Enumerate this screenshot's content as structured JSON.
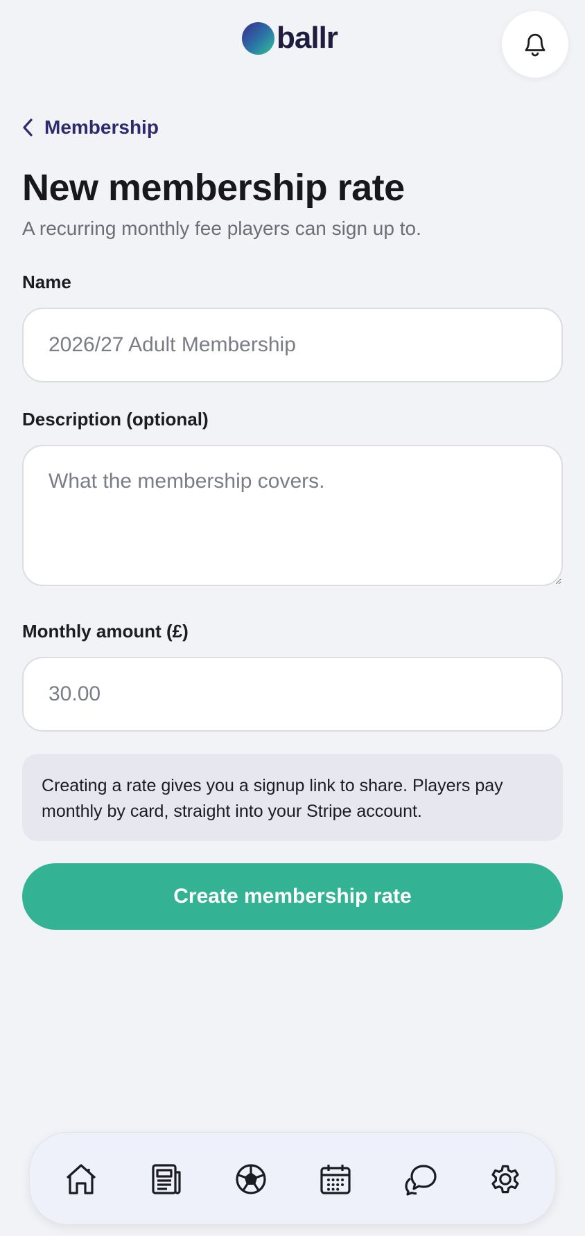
{
  "header": {
    "logo_text": "ballr",
    "notification_icon": "bell-icon"
  },
  "nav_back": {
    "label": "Membership",
    "icon": "chevron-left-icon"
  },
  "page": {
    "title": "New membership rate",
    "subtitle": "A recurring monthly fee players can sign up to."
  },
  "form": {
    "name": {
      "label": "Name",
      "placeholder": "2026/27 Adult Membership",
      "value": ""
    },
    "description": {
      "label": "Description (optional)",
      "placeholder": "What the membership covers.",
      "value": ""
    },
    "amount": {
      "label": "Monthly amount (£)",
      "placeholder": "30.00",
      "value": ""
    },
    "info_text": "Creating a rate gives you a signup link to share. Players pay monthly by card, straight into your Stripe account.",
    "submit_label": "Create membership rate"
  },
  "colors": {
    "accent": "#33b393",
    "brand_text": "#1f1d3f",
    "link": "#2d2a6e",
    "background": "#f2f3f6"
  },
  "bottom_nav": {
    "items": [
      {
        "icon": "home-icon"
      },
      {
        "icon": "news-icon"
      },
      {
        "icon": "football-icon"
      },
      {
        "icon": "calendar-icon"
      },
      {
        "icon": "chat-icon"
      },
      {
        "icon": "gear-icon"
      }
    ]
  }
}
